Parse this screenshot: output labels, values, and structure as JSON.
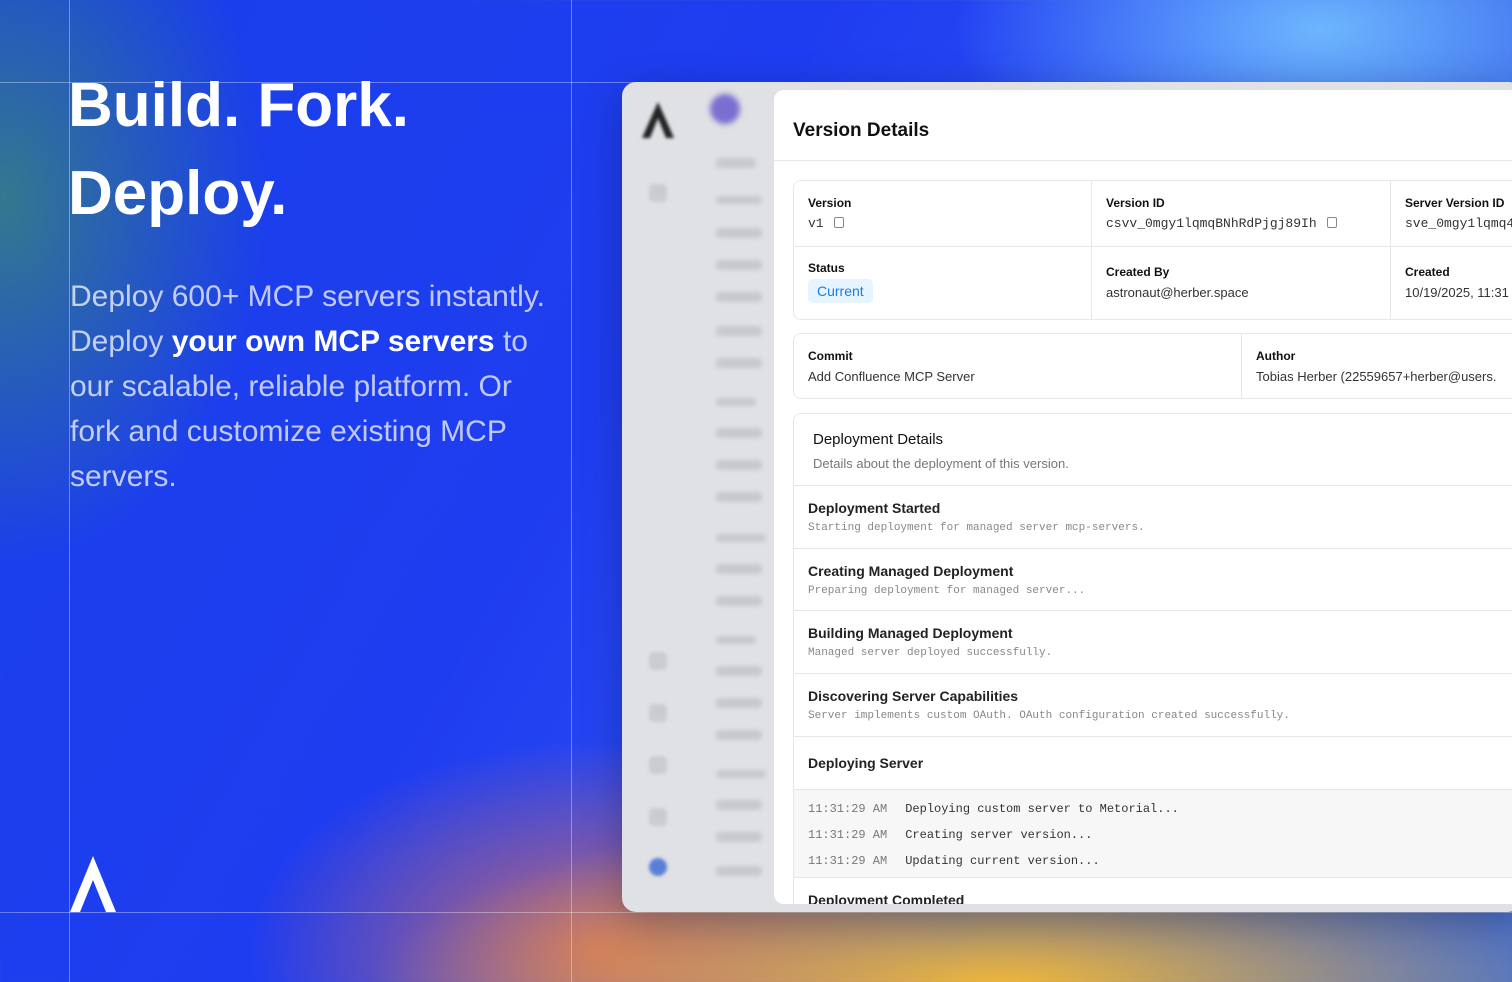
{
  "hero": {
    "headline_1": "Build. Fork.",
    "headline_2": "Deploy.",
    "sub_1": "Deploy 600+ MCP servers instantly. Deploy ",
    "sub_bold": "your own MCP servers",
    "sub_2": " to our scalable, reliable platform. Or fork and customize existing MCP servers."
  },
  "icons": {
    "brand": "metorial-logo-icon",
    "copy": "copy-icon"
  },
  "colors": {
    "badge_bg": "#e6f4ff",
    "badge_text": "#1a7ee0"
  },
  "panel": {
    "title": "Version Details",
    "version": {
      "label": "Version",
      "value": "v1"
    },
    "version_id": {
      "label": "Version ID",
      "value": "csvv_0mgy1lqmqBNhRdPjgj89Ih"
    },
    "server_version_id": {
      "label": "Server Version ID",
      "value": "sve_0mgy1lqmq4"
    },
    "status": {
      "label": "Status",
      "value": "Current"
    },
    "created_by": {
      "label": "Created By",
      "value": "astronaut@herber.space"
    },
    "created": {
      "label": "Created",
      "value": "10/19/2025, 11:31"
    },
    "commit": {
      "label": "Commit",
      "value": "Add Confluence MCP Server"
    },
    "author": {
      "label": "Author",
      "value": "Tobias Herber (22559657+herber@users."
    }
  },
  "deployment": {
    "title": "Deployment Details",
    "subtitle": "Details about the deployment of this version.",
    "steps": [
      {
        "title": "Deployment Started",
        "desc": "Starting deployment for managed server mcp-servers."
      },
      {
        "title": "Creating Managed Deployment",
        "desc": "Preparing deployment for managed server..."
      },
      {
        "title": "Building Managed Deployment",
        "desc": "Managed server deployed successfully."
      },
      {
        "title": "Discovering Server Capabilities",
        "desc": "Server implements custom OAuth. OAuth configuration created successfully."
      },
      {
        "title": "Deploying Server",
        "desc": ""
      },
      {
        "title": "Deployment Completed",
        "desc": ""
      }
    ],
    "logs": [
      {
        "time": "11:31:29 AM",
        "msg": "Deploying custom server to Metorial..."
      },
      {
        "time": "11:31:29 AM",
        "msg": "Creating server version..."
      },
      {
        "time": "11:31:29 AM",
        "msg": "Updating current version..."
      }
    ]
  }
}
